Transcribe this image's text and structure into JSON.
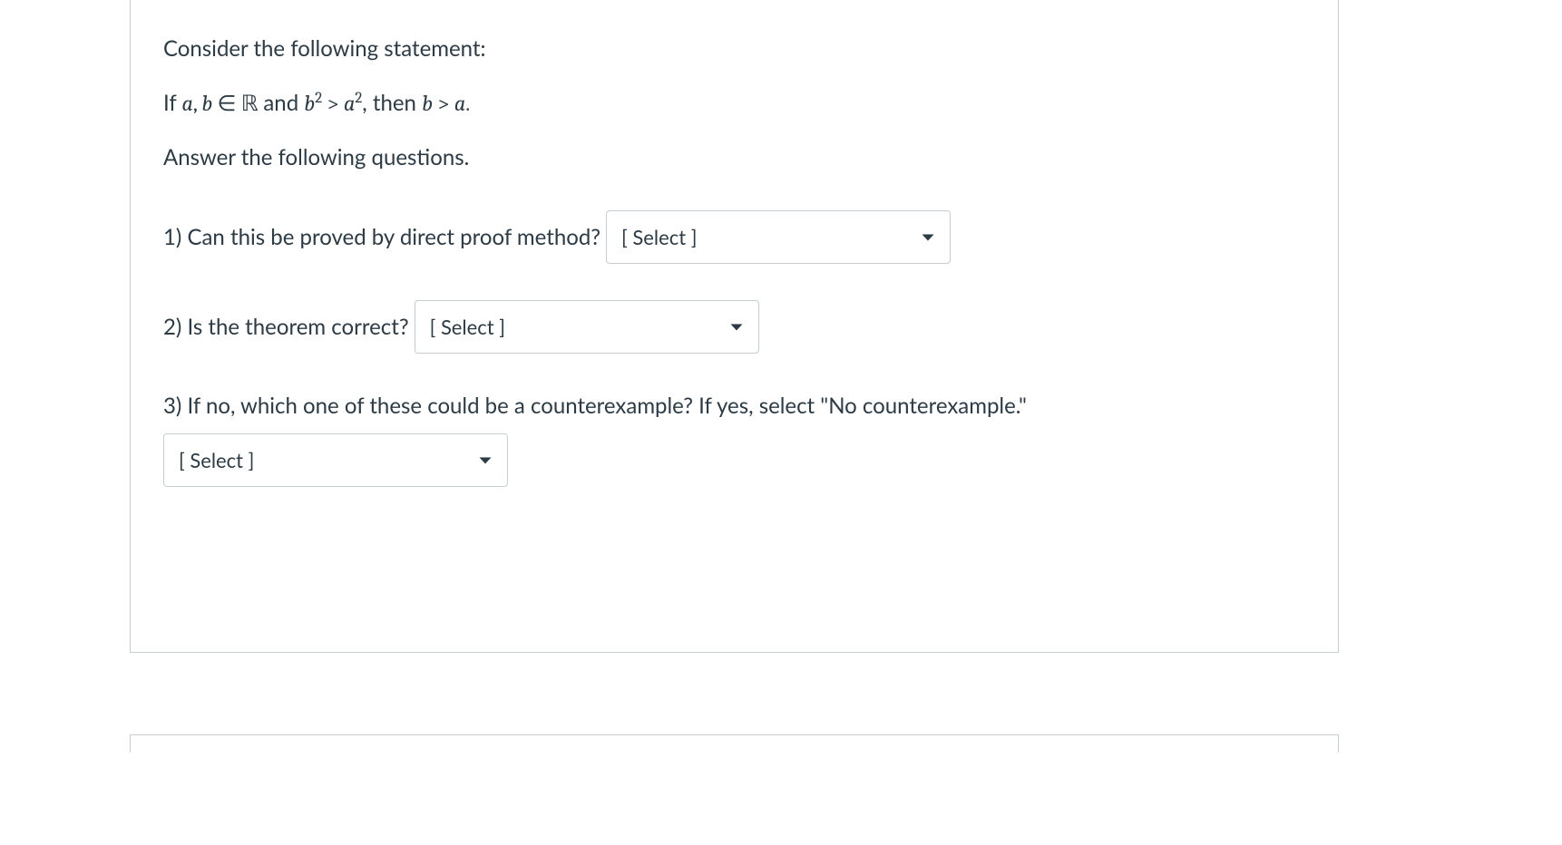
{
  "intro": {
    "line1": "Consider the following statement:",
    "theorem_prefix": "If ",
    "theorem_a": "a",
    "theorem_comma": ", ",
    "theorem_b": "b",
    "theorem_in": " ∈ ",
    "theorem_R": "ℝ",
    "theorem_and": " and ",
    "theorem_b2": "b",
    "theorem_sq1": "2",
    "theorem_gt1": " > ",
    "theorem_a2": "a",
    "theorem_sq2": "2",
    "theorem_then": ", then ",
    "theorem_b3": "b",
    "theorem_gt2": " > ",
    "theorem_a3": "a",
    "theorem_period": ".",
    "line3": "Answer the following questions."
  },
  "questions": {
    "q1": {
      "label": "1) Can this be proved by direct proof method?",
      "select_placeholder": "[ Select ]"
    },
    "q2": {
      "label": "2) Is the theorem correct?",
      "select_placeholder": "[ Select ]"
    },
    "q3": {
      "label": "3) If no, which one of these could be a counterexample? If yes, select \"No counterexample.\"",
      "select_placeholder": "[ Select ]"
    }
  }
}
